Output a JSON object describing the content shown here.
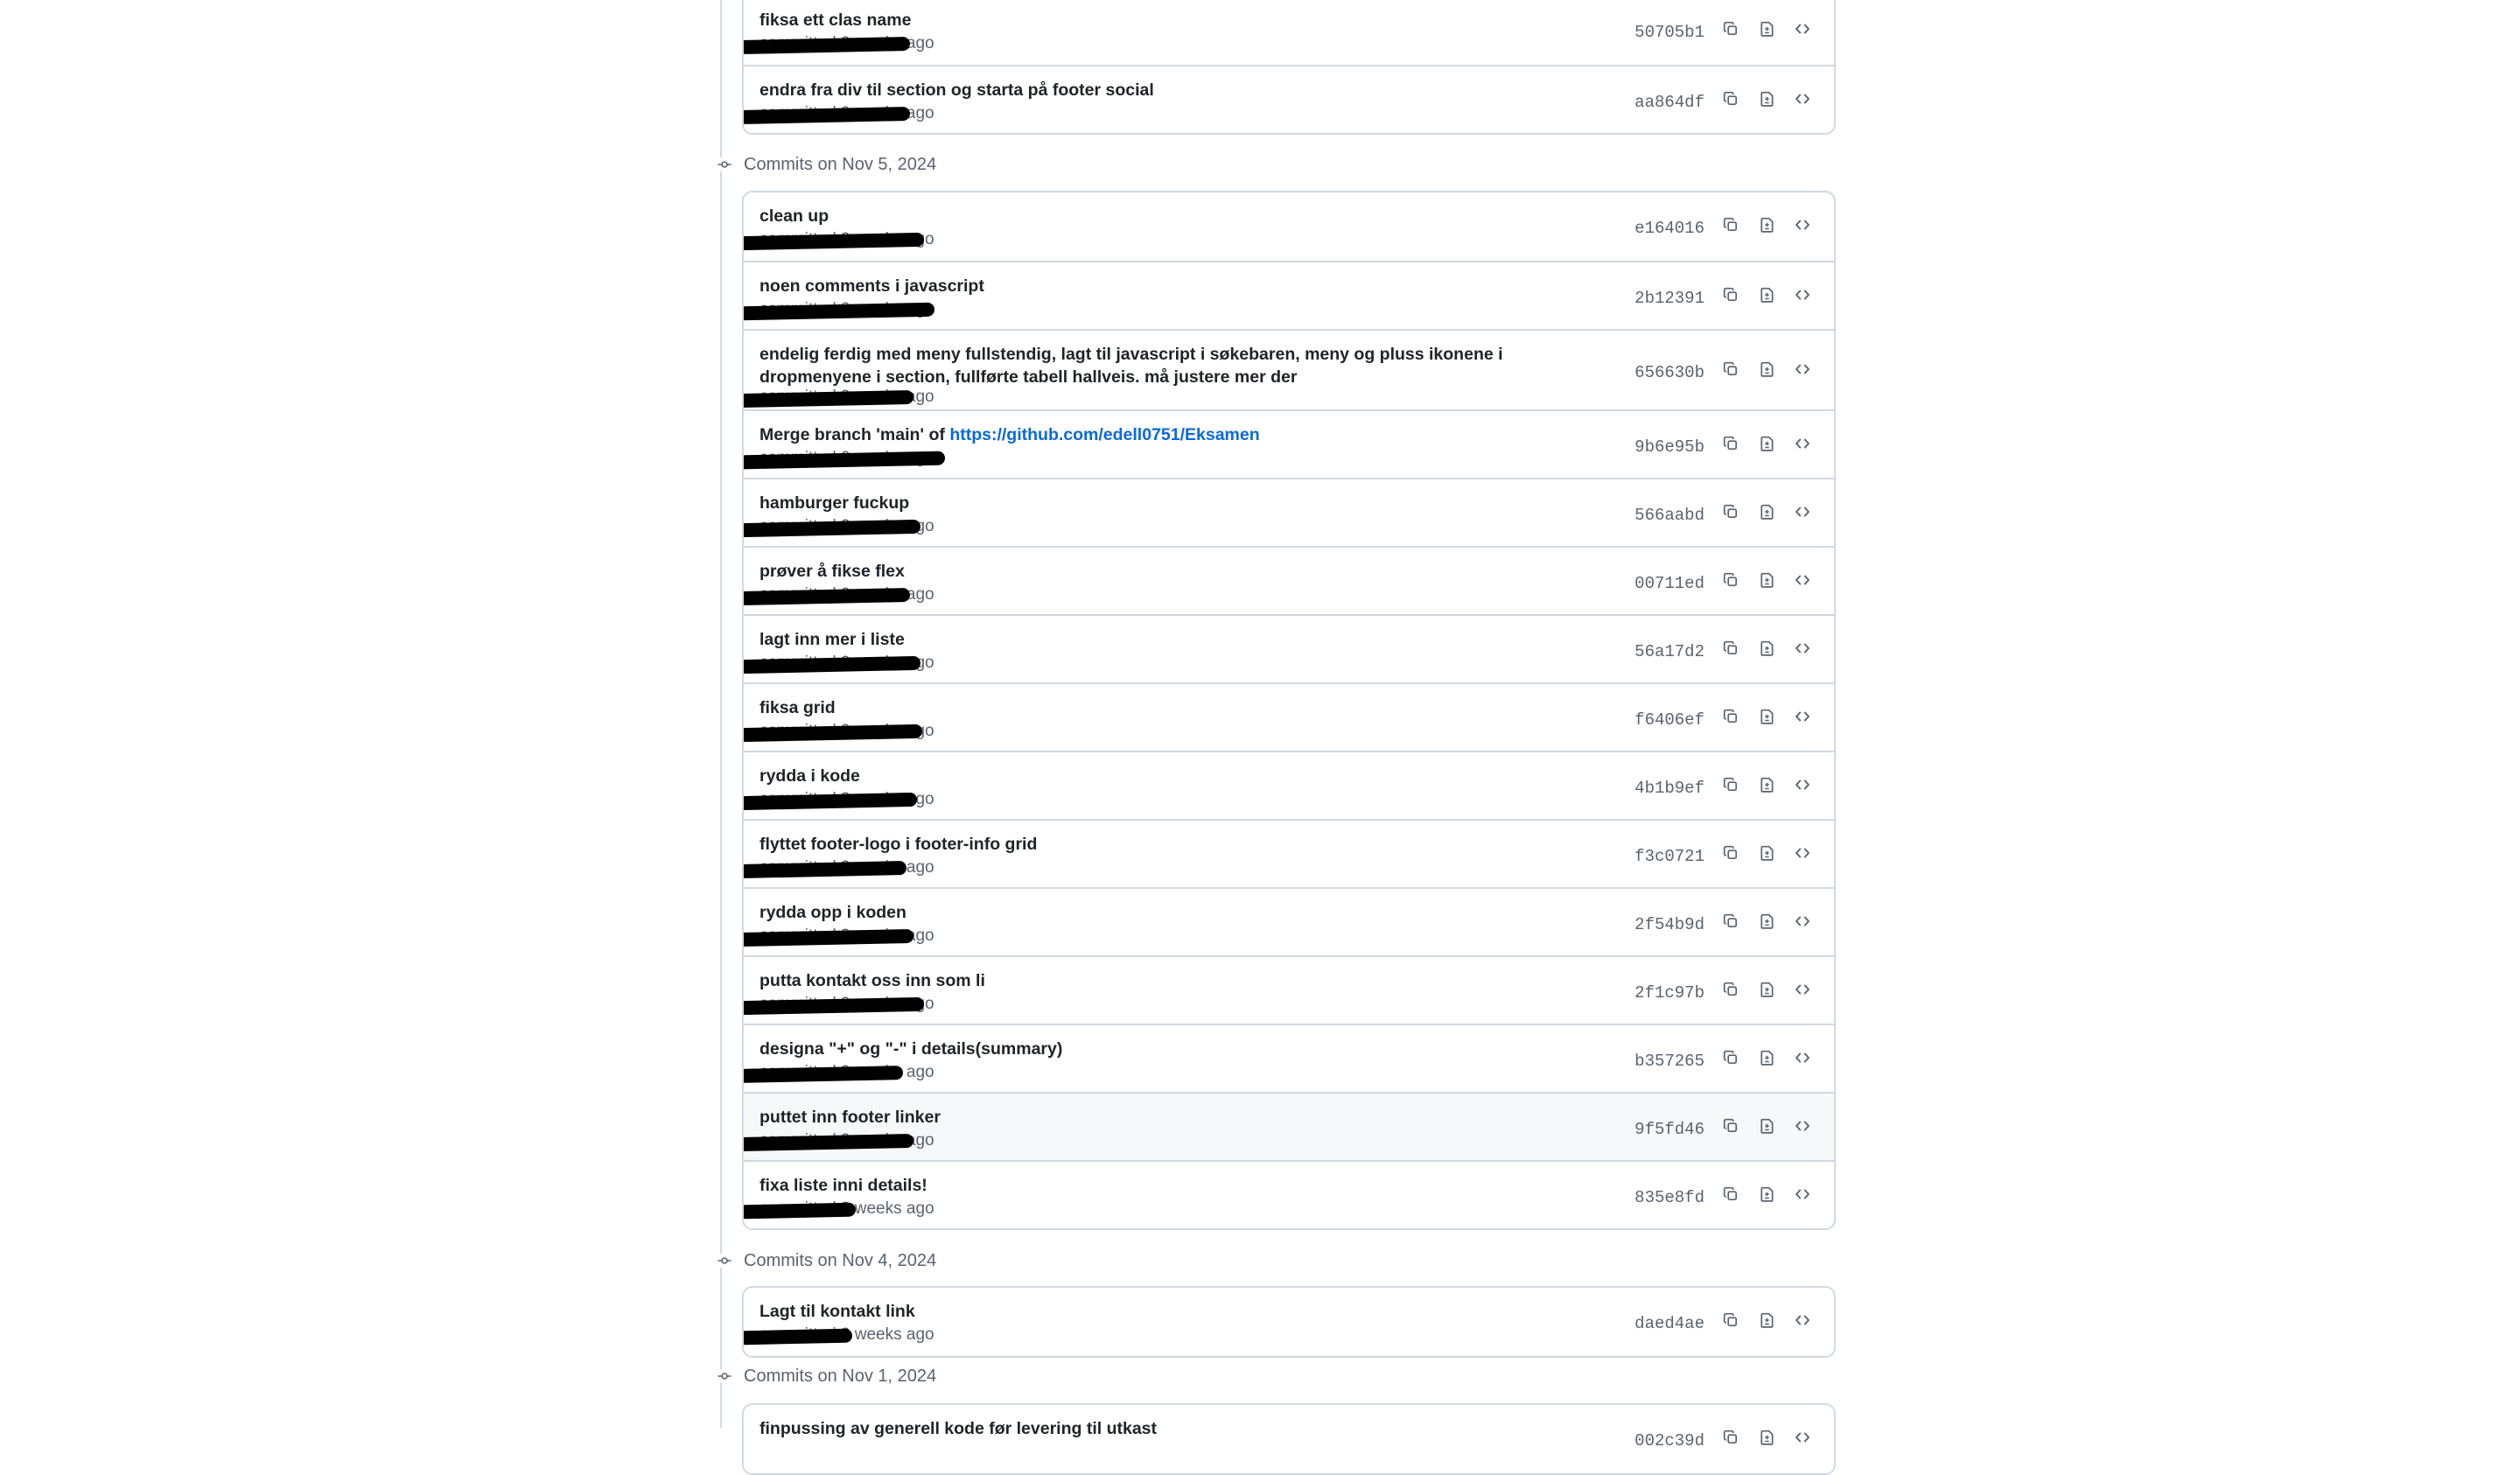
{
  "groups": [
    {
      "title": "",
      "commits": [
        {
          "message": "fiksa ett clas name",
          "meta": "committed 2 weeks ago",
          "sha": "50705b1"
        },
        {
          "message": "endra fra div til section og starta på footer social",
          "meta": "committed 2 weeks ago",
          "sha": "aa864df"
        }
      ]
    },
    {
      "title": "Commits on Nov 5, 2024",
      "commits": [
        {
          "message": "clean up",
          "meta": "committed 2 weeks ago",
          "sha": "e164016"
        },
        {
          "message": "noen comments i javascript",
          "meta": "committed 2 weeks ago",
          "sha": "2b12391"
        },
        {
          "message": "endelig ferdig med meny fullstendig, lagt til javascript i søkebaren, meny og pluss ikonene i dropmenyene i section, fullførte tabell hallveis. må justere mer der",
          "meta": "committed 2 weeks ago",
          "sha": "656630b"
        },
        {
          "message": "Merge branch 'main' of ",
          "link": "https://github.com/edell0751/Eksamen",
          "meta": "committed 2 weeks ago",
          "sha": "9b6e95b"
        },
        {
          "message": "hamburger fuckup",
          "meta": "committed 2 weeks ago",
          "sha": "566aabd"
        },
        {
          "message": "prøver å fikse flex",
          "meta": "committed 2 weeks ago",
          "sha": "00711ed"
        },
        {
          "message": "lagt inn mer i liste",
          "meta": "committed 2 weeks ago",
          "sha": "56a17d2"
        },
        {
          "message": "fiksa grid",
          "meta": "committed 2 weeks ago",
          "sha": "f6406ef"
        },
        {
          "message": "rydda i kode",
          "meta": "committed 2 weeks ago",
          "sha": "4b1b9ef"
        },
        {
          "message": "flyttet footer-logo i footer-info grid",
          "meta": "committed 2 weeks ago",
          "sha": "f3c0721"
        },
        {
          "message": "rydda opp i koden",
          "meta": "committed 2 weeks ago",
          "sha": "2f54b9d"
        },
        {
          "message": "putta kontakt oss inn som li",
          "meta": "committed 2 weeks ago",
          "sha": "2f1c97b"
        },
        {
          "message": "designa \"+\" og \"-\" i details(summary)",
          "meta": "committed 2 weeks ago",
          "sha": "b357265"
        },
        {
          "message": "puttet inn footer linker",
          "meta": "committed 2 weeks ago",
          "sha": "9f5fd46"
        },
        {
          "message": "fixa liste inni details!",
          "meta": "committed 2 weeks ago",
          "sha": "835e8fd"
        }
      ]
    },
    {
      "title": "Commits on Nov 4, 2024",
      "commits": [
        {
          "message": "Lagt til kontakt link",
          "meta": "committed 3 weeks ago",
          "sha": "daed4ae"
        }
      ]
    },
    {
      "title": "Commits on Nov 1, 2024",
      "commits": [
        {
          "message": "finpussing av generell kode før levering til utkast",
          "meta": "",
          "sha": "002c39d"
        }
      ]
    }
  ],
  "icons": {
    "copy": "copy-icon",
    "browse": "file-diff-icon",
    "code": "code-icon",
    "group": "git-commit-icon"
  },
  "colors": {
    "border": "#d1d9e0",
    "link": "#0969da",
    "muted": "#59636e",
    "hover_row": "#f6f8fa"
  }
}
